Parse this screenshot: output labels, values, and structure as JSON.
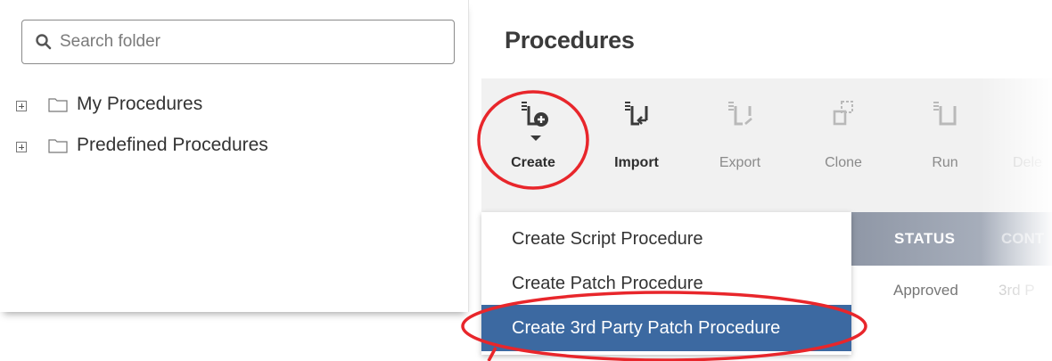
{
  "sidebar": {
    "search": {
      "placeholder": "Search folder"
    },
    "tree": [
      {
        "label": "My Procedures"
      },
      {
        "label": "Predefined Procedures"
      }
    ]
  },
  "header": {
    "title": "Procedures"
  },
  "toolbar": {
    "buttons": [
      {
        "label": "Create",
        "icon": "create-procedure-icon"
      },
      {
        "label": "Import",
        "icon": "import-procedure-icon"
      },
      {
        "label": "Export",
        "icon": "export-procedure-icon"
      },
      {
        "label": "Clone",
        "icon": "clone-procedure-icon"
      },
      {
        "label": "Run",
        "icon": "run-procedure-icon"
      },
      {
        "label": "Dele",
        "icon": "delete-procedure-icon"
      }
    ]
  },
  "create_menu": {
    "items": [
      {
        "label": "Create Script Procedure"
      },
      {
        "label": "Create Patch Procedure"
      },
      {
        "label": "Create 3rd Party Patch Procedure"
      }
    ]
  },
  "table": {
    "columns": [
      "STATUS",
      "CONT"
    ],
    "rows": [
      [
        "Approved",
        "3rd P"
      ]
    ]
  },
  "colors": {
    "accent": "#3c69a1",
    "annotation": "#e8262b",
    "icon": "#3a3a3a",
    "header_strip": "#9aa2b0"
  }
}
